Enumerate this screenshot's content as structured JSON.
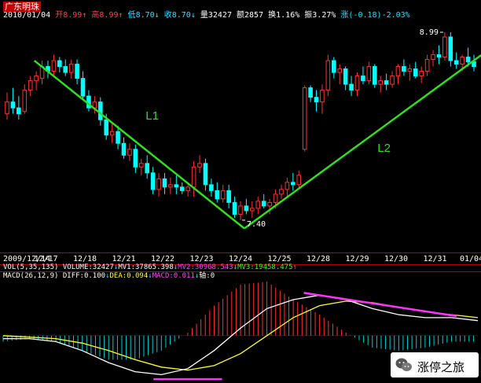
{
  "header": {
    "stock_name": "广东明珠",
    "date": "2010/01/04",
    "open_label": "开",
    "open_value": "8.99",
    "high_label": "高",
    "high_value": "8.99",
    "low_label": "低",
    "low_value": "8.70",
    "close_label": "收",
    "close_value": "8.70",
    "volume_label": "量",
    "volume_value": "32427",
    "amount_label": "额",
    "amount_value": "2857",
    "turnover_label": "换",
    "turnover_value": "1.16%",
    "amplitude_label": "振",
    "amplitude_value": "3.27%",
    "change_label": "涨",
    "change_value": "(-0.18)-2.03%"
  },
  "volume_indicator": {
    "name": "VOL(5,35,135)",
    "volume": "VOLUME:32427",
    "mv1": "MV1:37865.398",
    "mv2": "MV2:30968.543",
    "mv3": "MV3:19458.475"
  },
  "macd_indicator": {
    "name": "MACD(26,12,9)",
    "diff": "DIFF:0.100",
    "dea": "DEA:0.094",
    "macd": "MACD:0.011",
    "axis": "轴:0"
  },
  "watermark": {
    "text": "涨停之旅"
  },
  "chart_data": [
    {
      "type": "candlestick",
      "title": "广东明珠",
      "x_tick_labels": [
        "2009/12/14",
        "12/17",
        "12/18",
        "12/21",
        "12/22",
        "12/23",
        "12/24",
        "12/25",
        "12/28",
        "12/29",
        "12/30",
        "12/31",
        "01/04"
      ],
      "ylim": [
        7.2,
        9.05
      ],
      "annotations": [
        {
          "text": "8.99",
          "kind": "high-marker"
        },
        {
          "text": "7.40",
          "kind": "low-marker"
        },
        {
          "text": "L1",
          "kind": "trendline-label"
        },
        {
          "text": "L2",
          "kind": "trendline-label"
        }
      ],
      "trendlines": [
        {
          "name": "L1",
          "from": [
            0.7,
            8.75
          ],
          "to": [
            6.1,
            7.33
          ],
          "color": "#33dd22"
        },
        {
          "name": "L2",
          "from": [
            6.1,
            7.33
          ],
          "to": [
            12.7,
            8.92
          ],
          "color": "#33dd22"
        }
      ],
      "colors": {
        "up": "#ff3333",
        "down": "#00ffff",
        "trend": "#33dd22"
      },
      "candles": [
        {
          "o": 8.3,
          "h": 8.48,
          "l": 8.25,
          "c": 8.4
        },
        {
          "o": 8.4,
          "h": 8.52,
          "l": 8.3,
          "c": 8.35
        },
        {
          "o": 8.35,
          "h": 8.45,
          "l": 8.25,
          "c": 8.3
        },
        {
          "o": 8.32,
          "h": 8.55,
          "l": 8.3,
          "c": 8.5
        },
        {
          "o": 8.5,
          "h": 8.62,
          "l": 8.45,
          "c": 8.58
        },
        {
          "o": 8.58,
          "h": 8.66,
          "l": 8.5,
          "c": 8.62
        },
        {
          "o": 8.6,
          "h": 8.75,
          "l": 8.55,
          "c": 8.7
        },
        {
          "o": 8.7,
          "h": 8.75,
          "l": 8.6,
          "c": 8.66
        },
        {
          "o": 8.66,
          "h": 8.8,
          "l": 8.62,
          "c": 8.75
        },
        {
          "o": 8.75,
          "h": 8.78,
          "l": 8.65,
          "c": 8.7
        },
        {
          "o": 8.7,
          "h": 8.76,
          "l": 8.62,
          "c": 8.65
        },
        {
          "o": 8.65,
          "h": 8.76,
          "l": 8.6,
          "c": 8.72
        },
        {
          "o": 8.72,
          "h": 8.76,
          "l": 8.55,
          "c": 8.6
        },
        {
          "o": 8.6,
          "h": 8.66,
          "l": 8.42,
          "c": 8.45
        },
        {
          "o": 8.45,
          "h": 8.5,
          "l": 8.32,
          "c": 8.35
        },
        {
          "o": 8.35,
          "h": 8.45,
          "l": 8.3,
          "c": 8.4
        },
        {
          "o": 8.4,
          "h": 8.44,
          "l": 8.2,
          "c": 8.25
        },
        {
          "o": 8.25,
          "h": 8.3,
          "l": 8.08,
          "c": 8.12
        },
        {
          "o": 8.12,
          "h": 8.22,
          "l": 8.05,
          "c": 8.15
        },
        {
          "o": 8.15,
          "h": 8.2,
          "l": 8.0,
          "c": 8.05
        },
        {
          "o": 8.05,
          "h": 8.1,
          "l": 7.92,
          "c": 7.95
        },
        {
          "o": 7.95,
          "h": 8.05,
          "l": 7.9,
          "c": 8.0
        },
        {
          "o": 8.0,
          "h": 8.04,
          "l": 7.8,
          "c": 7.85
        },
        {
          "o": 7.85,
          "h": 7.92,
          "l": 7.78,
          "c": 7.88
        },
        {
          "o": 7.88,
          "h": 7.95,
          "l": 7.75,
          "c": 7.8
        },
        {
          "o": 7.8,
          "h": 7.85,
          "l": 7.62,
          "c": 7.66
        },
        {
          "o": 7.66,
          "h": 7.8,
          "l": 7.6,
          "c": 7.75
        },
        {
          "o": 7.75,
          "h": 7.8,
          "l": 7.62,
          "c": 7.68
        },
        {
          "o": 7.68,
          "h": 7.76,
          "l": 7.62,
          "c": 7.7
        },
        {
          "o": 7.7,
          "h": 7.78,
          "l": 7.62,
          "c": 7.68
        },
        {
          "o": 7.68,
          "h": 7.72,
          "l": 7.62,
          "c": 7.65
        },
        {
          "o": 7.65,
          "h": 7.72,
          "l": 7.6,
          "c": 7.68
        },
        {
          "o": 7.68,
          "h": 7.9,
          "l": 7.6,
          "c": 7.85
        },
        {
          "o": 7.85,
          "h": 7.95,
          "l": 7.8,
          "c": 7.88
        },
        {
          "o": 7.88,
          "h": 7.92,
          "l": 7.65,
          "c": 7.7
        },
        {
          "o": 7.7,
          "h": 7.75,
          "l": 7.6,
          "c": 7.65
        },
        {
          "o": 7.65,
          "h": 7.72,
          "l": 7.55,
          "c": 7.58
        },
        {
          "o": 7.58,
          "h": 7.7,
          "l": 7.55,
          "c": 7.65
        },
        {
          "o": 7.65,
          "h": 7.7,
          "l": 7.5,
          "c": 7.55
        },
        {
          "o": 7.55,
          "h": 7.6,
          "l": 7.42,
          "c": 7.45
        },
        {
          "o": 7.45,
          "h": 7.56,
          "l": 7.4,
          "c": 7.52
        },
        {
          "o": 7.52,
          "h": 7.58,
          "l": 7.45,
          "c": 7.48
        },
        {
          "o": 7.48,
          "h": 7.56,
          "l": 7.42,
          "c": 7.5
        },
        {
          "o": 7.5,
          "h": 7.6,
          "l": 7.45,
          "c": 7.56
        },
        {
          "o": 7.56,
          "h": 7.62,
          "l": 7.5,
          "c": 7.52
        },
        {
          "o": 7.52,
          "h": 7.58,
          "l": 7.45,
          "c": 7.55
        },
        {
          "o": 7.55,
          "h": 7.66,
          "l": 7.5,
          "c": 7.62
        },
        {
          "o": 7.62,
          "h": 7.7,
          "l": 7.58,
          "c": 7.66
        },
        {
          "o": 7.66,
          "h": 7.76,
          "l": 7.6,
          "c": 7.72
        },
        {
          "o": 7.72,
          "h": 7.8,
          "l": 7.65,
          "c": 7.7
        },
        {
          "o": 7.7,
          "h": 7.82,
          "l": 7.66,
          "c": 7.78
        },
        {
          "o": 8.0,
          "h": 8.54,
          "l": 7.98,
          "c": 8.52
        },
        {
          "o": 8.52,
          "h": 8.54,
          "l": 8.4,
          "c": 8.44
        },
        {
          "o": 8.44,
          "h": 8.5,
          "l": 8.32,
          "c": 8.4
        },
        {
          "o": 8.4,
          "h": 8.55,
          "l": 8.3,
          "c": 8.5
        },
        {
          "o": 8.5,
          "h": 8.8,
          "l": 8.45,
          "c": 8.75
        },
        {
          "o": 8.75,
          "h": 8.78,
          "l": 8.6,
          "c": 8.65
        },
        {
          "o": 8.65,
          "h": 8.72,
          "l": 8.55,
          "c": 8.68
        },
        {
          "o": 8.68,
          "h": 8.7,
          "l": 8.5,
          "c": 8.55
        },
        {
          "o": 8.55,
          "h": 8.62,
          "l": 8.45,
          "c": 8.5
        },
        {
          "o": 8.5,
          "h": 8.65,
          "l": 8.45,
          "c": 8.62
        },
        {
          "o": 8.62,
          "h": 8.7,
          "l": 8.55,
          "c": 8.58
        },
        {
          "o": 8.58,
          "h": 8.74,
          "l": 8.55,
          "c": 8.7
        },
        {
          "o": 8.7,
          "h": 8.72,
          "l": 8.52,
          "c": 8.55
        },
        {
          "o": 8.55,
          "h": 8.62,
          "l": 8.48,
          "c": 8.58
        },
        {
          "o": 8.58,
          "h": 8.64,
          "l": 8.5,
          "c": 8.55
        },
        {
          "o": 8.55,
          "h": 8.66,
          "l": 8.52,
          "c": 8.62
        },
        {
          "o": 8.62,
          "h": 8.72,
          "l": 8.55,
          "c": 8.7
        },
        {
          "o": 8.7,
          "h": 8.76,
          "l": 8.62,
          "c": 8.66
        },
        {
          "o": 8.66,
          "h": 8.72,
          "l": 8.58,
          "c": 8.68
        },
        {
          "o": 8.68,
          "h": 8.74,
          "l": 8.6,
          "c": 8.62
        },
        {
          "o": 8.62,
          "h": 8.7,
          "l": 8.56,
          "c": 8.66
        },
        {
          "o": 8.66,
          "h": 8.8,
          "l": 8.62,
          "c": 8.76
        },
        {
          "o": 8.76,
          "h": 8.84,
          "l": 8.7,
          "c": 8.8
        },
        {
          "o": 8.8,
          "h": 8.88,
          "l": 8.72,
          "c": 8.78
        },
        {
          "o": 8.78,
          "h": 8.99,
          "l": 8.75,
          "c": 8.95
        },
        {
          "o": 8.95,
          "h": 8.99,
          "l": 8.7,
          "c": 8.75
        },
        {
          "o": 8.75,
          "h": 8.82,
          "l": 8.68,
          "c": 8.72
        },
        {
          "o": 8.72,
          "h": 8.8,
          "l": 8.66,
          "c": 8.78
        },
        {
          "o": 8.78,
          "h": 8.86,
          "l": 8.7,
          "c": 8.74
        },
        {
          "o": 8.74,
          "h": 8.8,
          "l": 8.66,
          "c": 8.7
        }
      ]
    },
    {
      "type": "bar",
      "title": "VOL(5,35,135)",
      "values": []
    },
    {
      "type": "line",
      "title": "MACD(26,12,9)",
      "ylim": [
        -0.3,
        0.35
      ],
      "series": [
        {
          "name": "DIFF",
          "color": "#ffffff",
          "values": [
            -0.02,
            -0.02,
            -0.04,
            -0.1,
            -0.18,
            -0.24,
            -0.26,
            -0.22,
            -0.1,
            0.05,
            0.18,
            0.24,
            0.27,
            0.24,
            0.18,
            0.14,
            0.12,
            0.12,
            0.1
          ]
        },
        {
          "name": "DEA",
          "color": "#ffff33",
          "values": [
            0.0,
            -0.01,
            -0.02,
            -0.05,
            -0.1,
            -0.16,
            -0.21,
            -0.23,
            -0.2,
            -0.12,
            0.0,
            0.12,
            0.2,
            0.23,
            0.22,
            0.19,
            0.16,
            0.14,
            0.12
          ]
        },
        {
          "name": "MACD",
          "color": "#ff4444",
          "values": [
            -0.04,
            -0.02,
            -0.04,
            -0.1,
            -0.16,
            -0.16,
            -0.1,
            0.02,
            0.2,
            0.34,
            0.36,
            0.24,
            0.14,
            0.02,
            -0.08,
            -0.1,
            -0.08,
            -0.04,
            -0.04
          ]
        }
      ]
    }
  ]
}
